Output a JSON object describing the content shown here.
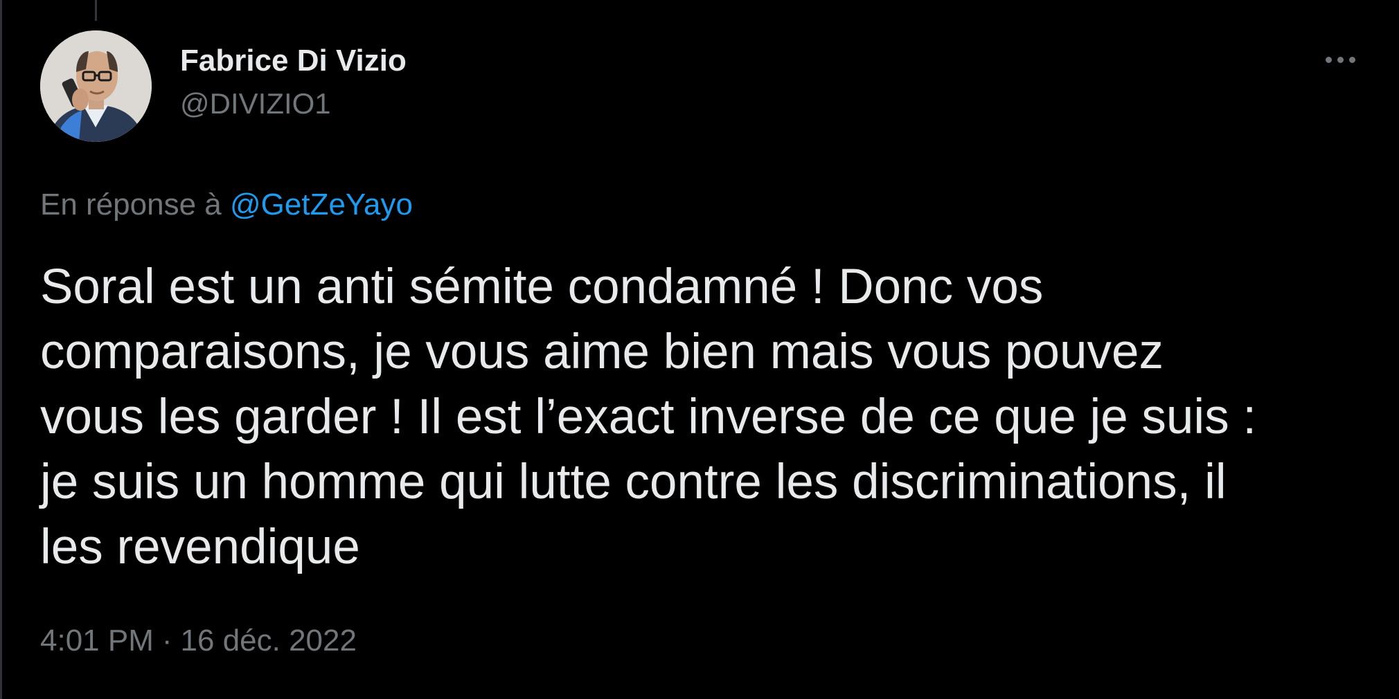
{
  "author": {
    "display_name": "Fabrice Di Vizio",
    "handle": "@DIVIZIO1",
    "avatar_icon": "profile-photo"
  },
  "more_icon": "more-horizontal-icon",
  "reply": {
    "prefix": "En réponse à",
    "mention": "@GetZeYayo"
  },
  "tweet": {
    "lines": [
      "Soral est un anti sémite condamné ! Donc vos",
      "comparaisons, je vous aime bien mais vous pouvez",
      "vous les garder ! Il est l’exact inverse de ce que je suis :",
      "je suis un homme qui lutte contre les discriminations, il",
      "les revendique"
    ]
  },
  "meta": {
    "time": "4:01 PM",
    "separator": "·",
    "date": "16 déc. 2022"
  },
  "colors": {
    "background": "#000000",
    "text": "#e7e9ea",
    "secondary": "#71767b",
    "link": "#1d9bf0"
  }
}
